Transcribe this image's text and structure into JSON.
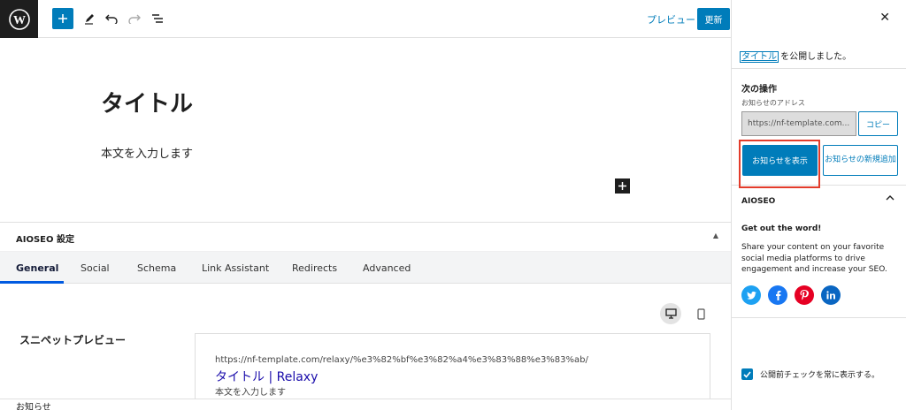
{
  "toolbar": {
    "preview_label": "プレビュー",
    "update_label": "更新"
  },
  "editor": {
    "title": "タイトル",
    "body": "本文を入力します"
  },
  "aioseo": {
    "header": "AIOSEO 設定",
    "tabs": [
      "General",
      "Social",
      "Schema",
      "Link Assistant",
      "Redirects",
      "Advanced"
    ],
    "active_tab": "General",
    "snippet_label": "スニペットプレビュー",
    "snippet_url": "https://nf-template.com/relaxy/%e3%82%bf%e3%82%a4%e3%83%88%e3%83%ab/",
    "snippet_title": "タイトル | Relaxy",
    "snippet_desc": "本文を入力します"
  },
  "footer": {
    "breadcrumb": "お知らせ"
  },
  "sidebar": {
    "published_link": "タイトル",
    "published_text": " を公開しました。",
    "next_title": "次の操作",
    "addr_label": "お知らせのアドレス",
    "addr_value": "https://nf-template.com...",
    "copy_label": "コピー",
    "view_label": "お知らせを表示",
    "new_label_1": "お知らせの新規",
    "new_label_2": "追加",
    "aio_title": "AIOSEO",
    "aio_get": "Get out the word!",
    "aio_desc": "Share your content on your favorite social media platforms to drive engagement and increase your SEO.",
    "check_label": "公開前チェックを常に表示する。"
  },
  "colors": {
    "accent": "#007cba",
    "highlight": "#e33c2b",
    "twitter": "#1da1f2",
    "facebook": "#1877f2",
    "pinterest": "#e60023",
    "linkedin": "#0a66c2"
  }
}
